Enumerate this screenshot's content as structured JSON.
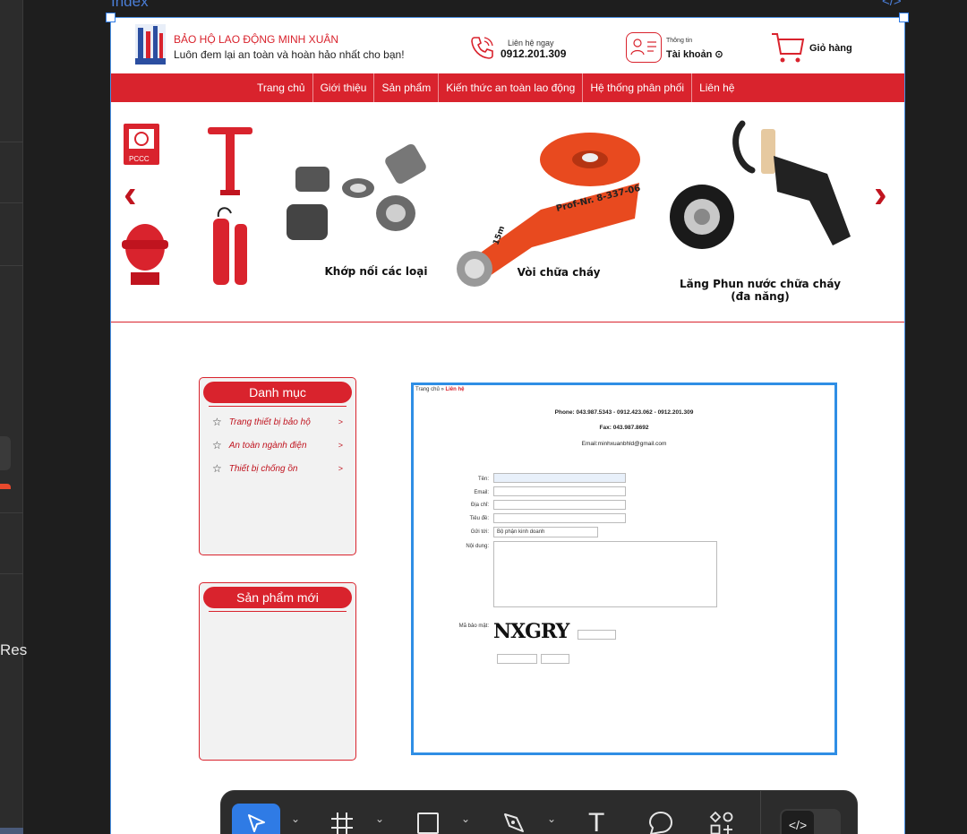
{
  "editor": {
    "frame_name": "Index",
    "code_corner_glyph": "</>",
    "left_panel_text": "Res",
    "toolbar": {
      "tools": [
        {
          "name": "move-tool",
          "icon": "pointer-icon"
        },
        {
          "name": "frame-tool",
          "icon": "hash-frame-icon"
        },
        {
          "name": "shape-tool",
          "icon": "rectangle-icon"
        },
        {
          "name": "pen-tool",
          "icon": "pen-icon"
        },
        {
          "name": "text-tool",
          "icon": "text-icon",
          "glyph": "T"
        },
        {
          "name": "comment-tool",
          "icon": "comment-icon"
        },
        {
          "name": "resources-tool",
          "icon": "components-icon"
        }
      ],
      "dev_mode_glyph": "</>"
    }
  },
  "site": {
    "brand": "BẢO HỘ LAO ĐỘNG MINH XUÂN",
    "slogan": "Luôn đem lại an toàn và hoàn hảo nhất cho bạn!",
    "contact_label": "Liên hệ ngay",
    "contact_number": "0912.201.309",
    "account_label": "Thông tin",
    "account_name": "Tài khoản ⊙",
    "cart_label": "Giỏ hàng",
    "nav": [
      "Trang chủ",
      "Giới thiệu",
      "Sản phẩm",
      "Kiến thức an toàn lao động",
      "Hệ thống phân phối",
      "Liên hệ"
    ],
    "banner": {
      "captions": [
        "Khớp nối các loại",
        "Vòi chữa cháy",
        "Lăng Phun nước chữa cháy",
        "(đa năng)"
      ],
      "cabinet_label": "PCCC",
      "hose_label": "Prof-Nr. 8-337-06",
      "hose_size": "15m",
      "prev": "‹",
      "next": "›"
    },
    "categories": {
      "title": "Danh mục",
      "items": [
        {
          "label": "Trang thiết bị bảo hộ",
          "arrow": ">"
        },
        {
          "label": "An toàn ngành điện",
          "arrow": ">"
        },
        {
          "label": "Thiết bị chống ồn",
          "arrow": ">"
        }
      ],
      "star": "☆"
    },
    "new_products": {
      "title": "Sản phẩm mới"
    },
    "contact_form": {
      "breadcrumb_home": "Trang chủ » ",
      "breadcrumb_current": "Liên hệ",
      "phone": "Phone: 043.987.5343 - 0912.423.062 - 0912.201.309",
      "fax": "Fax: 043.987.8692",
      "email": "Email:minhxuanbhld@gmail.com",
      "labels": {
        "name": "Tên:",
        "email": "Email:",
        "address": "Địa chỉ:",
        "subject": "Tiêu đề:",
        "send_to": "Gửi tới:",
        "content": "Nội dung:",
        "captcha": "Mã bảo mật:"
      },
      "send_to_value": "Bộ phận kinh doanh",
      "captcha_text": "NXGRY"
    }
  }
}
